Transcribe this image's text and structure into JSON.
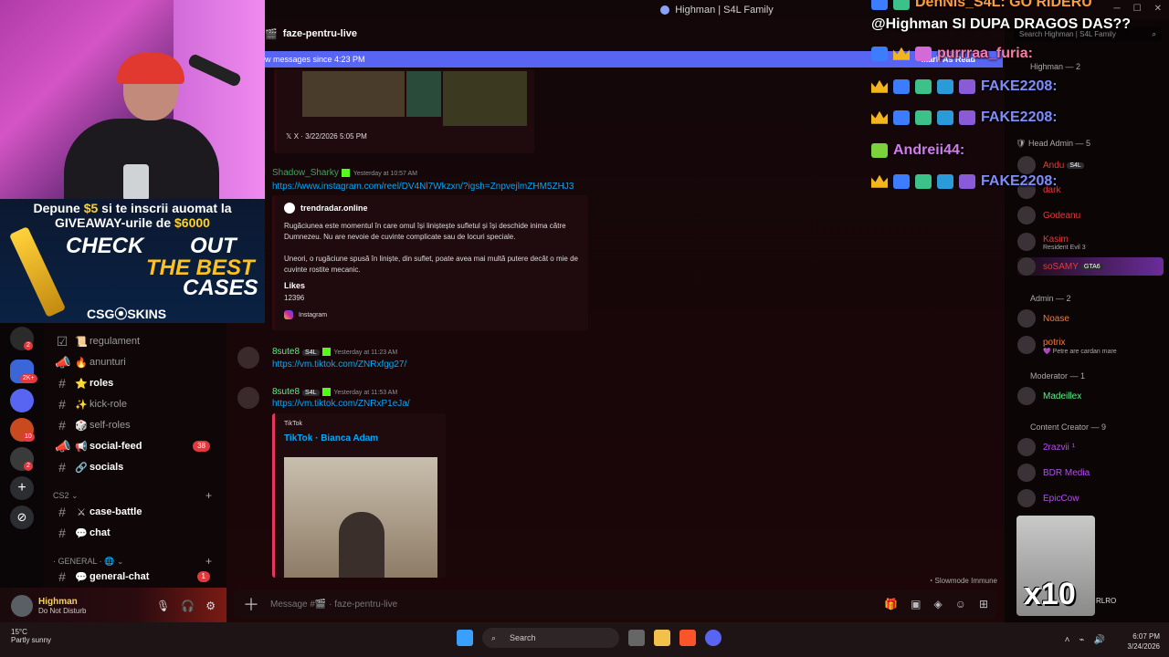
{
  "window": {
    "title": "Highman | S4L Family"
  },
  "stream": {
    "ad": {
      "line1_a": "Depune ",
      "line1_b": "$5",
      "line1_c": " si te inscrii auomat la",
      "line2_a": "GIVEAWAY-urile de ",
      "line2_b": "$6000",
      "check": "CHECK",
      "out": "OUT",
      "best": "THE BEST",
      "cases": "CASES",
      "brand": "CSG⦿SKINS"
    },
    "overlay_lines": [
      {
        "text": "DenNis_S4L: GO RIDERU",
        "color": "#ff9e3b"
      },
      {
        "text": "@Highman SI DUPA DRAGOS DAS??",
        "color": "#ffffff"
      },
      {
        "text": "purrraa_furia:",
        "color": "#ff7aa8"
      },
      {
        "text": "FAKE2208:",
        "color": "#7f8cff"
      },
      {
        "text": "FAKE2208:",
        "color": "#7f8cff"
      },
      {
        "text": "Andreii44:",
        "color": "#d27cf0"
      },
      {
        "text": "FAKE2208:",
        "color": "#7f8cff"
      }
    ],
    "x10": "x10"
  },
  "channel_header": {
    "name": "faze-pentru-live"
  },
  "new_messages_bar": {
    "text": "w messages since 4:23 PM",
    "mark": "Mark As Read"
  },
  "servers": [
    {
      "badge": "2",
      "color": "#2b2b2b"
    },
    {
      "badge": "2K+",
      "color": "#3a66d8"
    },
    {
      "badge": "",
      "color": "#5865f2"
    },
    {
      "badge": "10",
      "color": "#c84a1e"
    },
    {
      "badge": "2",
      "color": "#3a3a3a"
    }
  ],
  "channels": [
    {
      "emoji": "📜",
      "name": "regulament",
      "bold": false
    },
    {
      "emoji": "🔥",
      "name": "anunturi",
      "bold": false
    },
    {
      "emoji": "⭐",
      "name": "roles",
      "bold": true
    },
    {
      "emoji": "✨",
      "name": "kick-role",
      "bold": false
    },
    {
      "emoji": "🎲",
      "name": "self-roles",
      "bold": false
    },
    {
      "emoji": "📢",
      "name": "social-feed",
      "bold": true,
      "count": "38"
    },
    {
      "emoji": "🔗",
      "name": "socials",
      "bold": true
    },
    {
      "emoji": "⚔",
      "name": "case-battle",
      "bold": true
    },
    {
      "emoji": "💬",
      "name": "chat",
      "bold": true
    },
    {
      "emoji": "💬",
      "name": "general-chat",
      "bold": true,
      "count": "1"
    }
  ],
  "categories": {
    "cs2": "CS2 ⌄",
    "general": "· GENERAL · 🌐 ⌄"
  },
  "user": {
    "name": "Highman",
    "status": "Do Not Disturb"
  },
  "messages": {
    "embed1_footer": "X · 3/22/2026 5:05 PM",
    "msg1": {
      "author": "Shadow_Sharky",
      "time": "Yesterday at 10:57 AM",
      "link": "https://www.instagram.com/reel/DV4Nl7Wkzxn/?igsh=ZnpvejlmZHM5ZHJ3",
      "embed_site": "trendradar.online",
      "embed_p1": "Rugăciunea este momentul în care omul își liniștește sufletul și își deschide inima către Dumnezeu. Nu are nevoie de cuvinte complicate sau de locuri speciale.",
      "embed_p2": "Uneori, o rugăciune spusă în liniște, din suflet, poate avea mai multă putere decât o mie de cuvinte rostite mecanic.",
      "likes_label": "Likes",
      "likes_value": "12396",
      "footer": "Instagram"
    },
    "msg2": {
      "author": "8sute8",
      "tag": "S4L",
      "time": "Yesterday at 11:23 AM",
      "link": "https://vm.tiktok.com/ZNRxfgg27/"
    },
    "msg3": {
      "author": "8sute8",
      "tag": "S4L",
      "time": "Yesterday at 11:53 AM",
      "link": "https://vm.tiktok.com/ZNRxP1eJa/",
      "embed_provider": "TikTok",
      "embed_title": "TikTok · Bianca Adam"
    }
  },
  "composer": {
    "placeholder": "Message #🎬 · faze-pentru-live",
    "slowmode": "Slowmode Immune"
  },
  "members": {
    "search_placeholder": "Search Highman | S4L Family",
    "groups": [
      {
        "label": "Head Admin — 5"
      },
      {
        "label": "Admin — 2"
      },
      {
        "label": "Moderator — 1"
      },
      {
        "label": "Content Creator — 9"
      }
    ],
    "top_partial": "Highman — 2",
    "head_admins": [
      {
        "name": "Andu",
        "tag": "S4L",
        "color": "#e23b3b",
        "sub": ""
      },
      {
        "name": "dark",
        "color": "#e23b3b",
        "sub": ""
      },
      {
        "name": "Godeanu",
        "color": "#e23b3b",
        "sub": ""
      },
      {
        "name": "Kasim",
        "color": "#e23b3b",
        "sub": "Resident Evil 3"
      },
      {
        "name": "soSAMY",
        "color": "#e23b3b",
        "sub": "",
        "tag": "GTA6"
      }
    ],
    "admins": [
      {
        "name": "Noase",
        "color": "#f07a3b",
        "sub": ""
      },
      {
        "name": "potrix",
        "color": "#f07a3b",
        "sub": "💜 Petre are cardan mare"
      }
    ],
    "moderators": [
      {
        "name": "Madeillex",
        "color": "#57f287",
        "sub": ""
      }
    ],
    "creators": [
      {
        "name": "2razvii ¹",
        "color": "#b14ef0",
        "sub": ""
      },
      {
        "name": "BDR Media",
        "color": "#b14ef0",
        "sub": ""
      },
      {
        "name": "EpicCow",
        "color": "#b14ef0",
        "sub": ""
      }
    ],
    "partial_bottom": "RLRO"
  },
  "taskbar": {
    "temp": "15°C",
    "weather": "Partly sunny",
    "search": "Search",
    "time": "6:07 PM",
    "date": "3/24/2026"
  }
}
